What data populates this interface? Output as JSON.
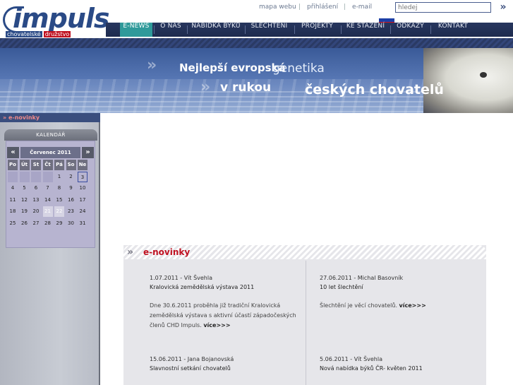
{
  "logo": {
    "word": "impuls",
    "tag_left": "chovatelské",
    "tag_right": "družstvo"
  },
  "toplinks": {
    "sitemap": "mapa webu",
    "login": "přihlášení",
    "email": "e-mail",
    "sep": "|"
  },
  "search": {
    "placeholder": "hledej",
    "go": "»"
  },
  "nav": [
    {
      "label": "E-NEWS",
      "active": true
    },
    {
      "label": "O NÁS",
      "active": false
    },
    {
      "label": "NABÍDKA BÝKŮ",
      "active": false
    },
    {
      "label": "ŠLECHTĚNÍ",
      "active": false
    },
    {
      "label": "PROJEKTY",
      "active": false
    },
    {
      "label": "KE STAŽENÍ",
      "active": false
    },
    {
      "label": "ODKAZY",
      "active": false
    },
    {
      "label": "KONTAKT",
      "active": false
    }
  ],
  "flag": {
    "colors": [
      "#ffffff",
      "#1c3fa6",
      "#d8141e"
    ]
  },
  "banner": {
    "line1_bold": "Nejlepší evropská",
    "line1_light": "genetika",
    "line2_a": "v rukou",
    "line2_b": "českých chovatelů",
    "chevron": "»"
  },
  "sidebar": {
    "section_label": "» e-novinky",
    "calendar_title": "KALENDÁŘ"
  },
  "calendar": {
    "prev": "«",
    "next": "»",
    "month": "Červenec 2011",
    "weekdays": [
      "Po",
      "Út",
      "St",
      "Čt",
      "Pá",
      "So",
      "Ne"
    ],
    "weeks": [
      [
        "",
        "",
        "",
        "",
        "1",
        "2",
        "3"
      ],
      [
        "4",
        "5",
        "6",
        "7",
        "8",
        "9",
        "10"
      ],
      [
        "11",
        "12",
        "13",
        "14",
        "15",
        "16",
        "17"
      ],
      [
        "18",
        "19",
        "20",
        "21",
        "22",
        "23",
        "24"
      ],
      [
        "25",
        "26",
        "27",
        "28",
        "29",
        "30",
        "31"
      ]
    ],
    "today": "3",
    "greyed": [
      "21",
      "22"
    ]
  },
  "news_section": {
    "chevron": "»",
    "title": "e-novinky"
  },
  "news": [
    {
      "meta": "1.07.2011 - Vít Švehla",
      "title": "Kralovická zemědělská výstava 2011",
      "body": "Dne 30.6.2011 proběhla již tradiční Kralovická zemědělská výstava s aktivní účastí západočeských členů CHD Impuls.",
      "more": "více>>>"
    },
    {
      "meta": "27.06.2011 - Michal Basovník",
      "title": "10 let šlechtění",
      "body": "Šlechtění je věcí chovatelů.",
      "more": "více>>>"
    },
    {
      "meta": "15.06.2011 - Jana Bojanovská",
      "title": "Slavnostní setkání chovatelů",
      "body": "",
      "more": ""
    },
    {
      "meta": "5.06.2011 - Vít Švehla",
      "title": "Nová nabídka býků ČR- květen 2011",
      "body": "",
      "more": ""
    }
  ]
}
